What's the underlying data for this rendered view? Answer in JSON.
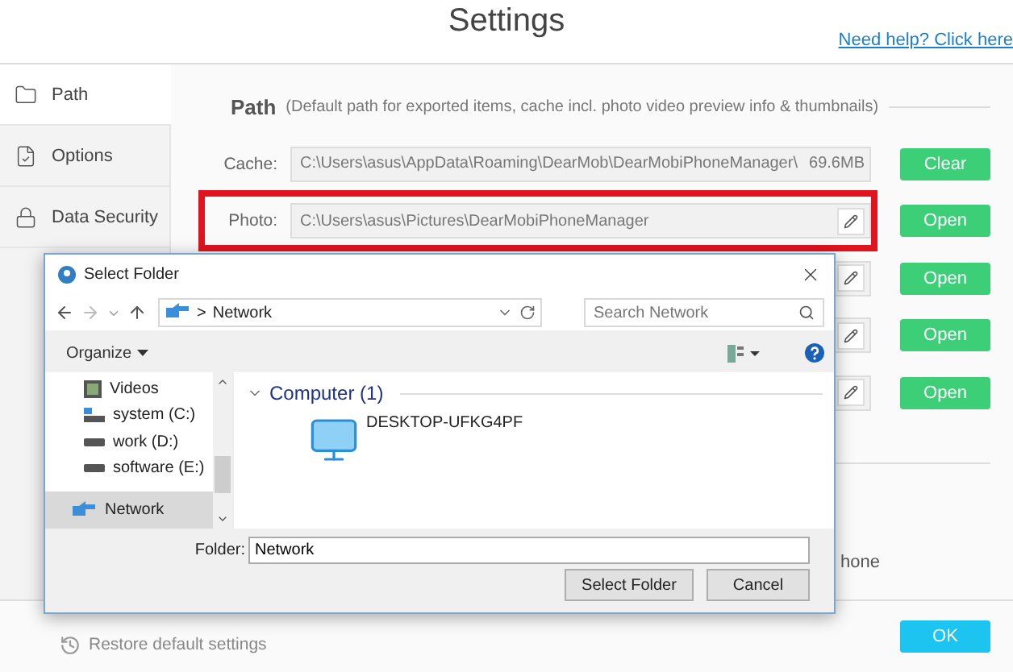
{
  "window": {
    "title": "Settings",
    "help_link": "Need help? Click here"
  },
  "sidebar": {
    "items": [
      {
        "label": "Path",
        "selected": true
      },
      {
        "label": "Options",
        "selected": false
      },
      {
        "label": "Data Security",
        "selected": false
      }
    ]
  },
  "path_section": {
    "title": "Path",
    "note": "(Default path for exported items, cache incl. photo video preview info & thumbnails)",
    "rows": [
      {
        "kind": "size",
        "label": "Cache:",
        "value": "C:\\Users\\asus\\AppData\\Roaming\\DearMob\\DearMobiPhoneManager\\",
        "size": "69.6MB",
        "button": "Clear",
        "highlighted": false
      },
      {
        "kind": "edit",
        "label": "Photo:",
        "value": "C:\\Users\\asus\\Pictures\\DearMobiPhoneManager",
        "button": "Open",
        "highlighted": true
      },
      {
        "kind": "edit",
        "button": "Open",
        "highlighted": false
      },
      {
        "kind": "edit",
        "button": "Open",
        "highlighted": false
      },
      {
        "kind": "edit",
        "button": "Open",
        "highlighted": false
      }
    ]
  },
  "partial_text": "hone",
  "footer": {
    "restore": "Restore default settings",
    "ok": "OK"
  },
  "dialog": {
    "title": "Select Folder",
    "address_separator": ">",
    "address": "Network",
    "search_placeholder": "Search Network",
    "organize": "Organize",
    "tree": [
      {
        "label": "Videos",
        "kind": "video",
        "selected": false
      },
      {
        "label": "system (C:)",
        "kind": "system",
        "selected": false
      },
      {
        "label": "work (D:)",
        "kind": "drive",
        "selected": false
      },
      {
        "label": "software (E:)",
        "kind": "drive",
        "selected": false
      },
      {
        "label": "Network",
        "kind": "network",
        "selected": true
      }
    ],
    "group": "Computer (1)",
    "items": [
      "DESKTOP-UFKG4PF"
    ],
    "folder_label": "Folder:",
    "folder_value": "Network",
    "buttons": [
      "Select Folder",
      "Cancel"
    ]
  }
}
